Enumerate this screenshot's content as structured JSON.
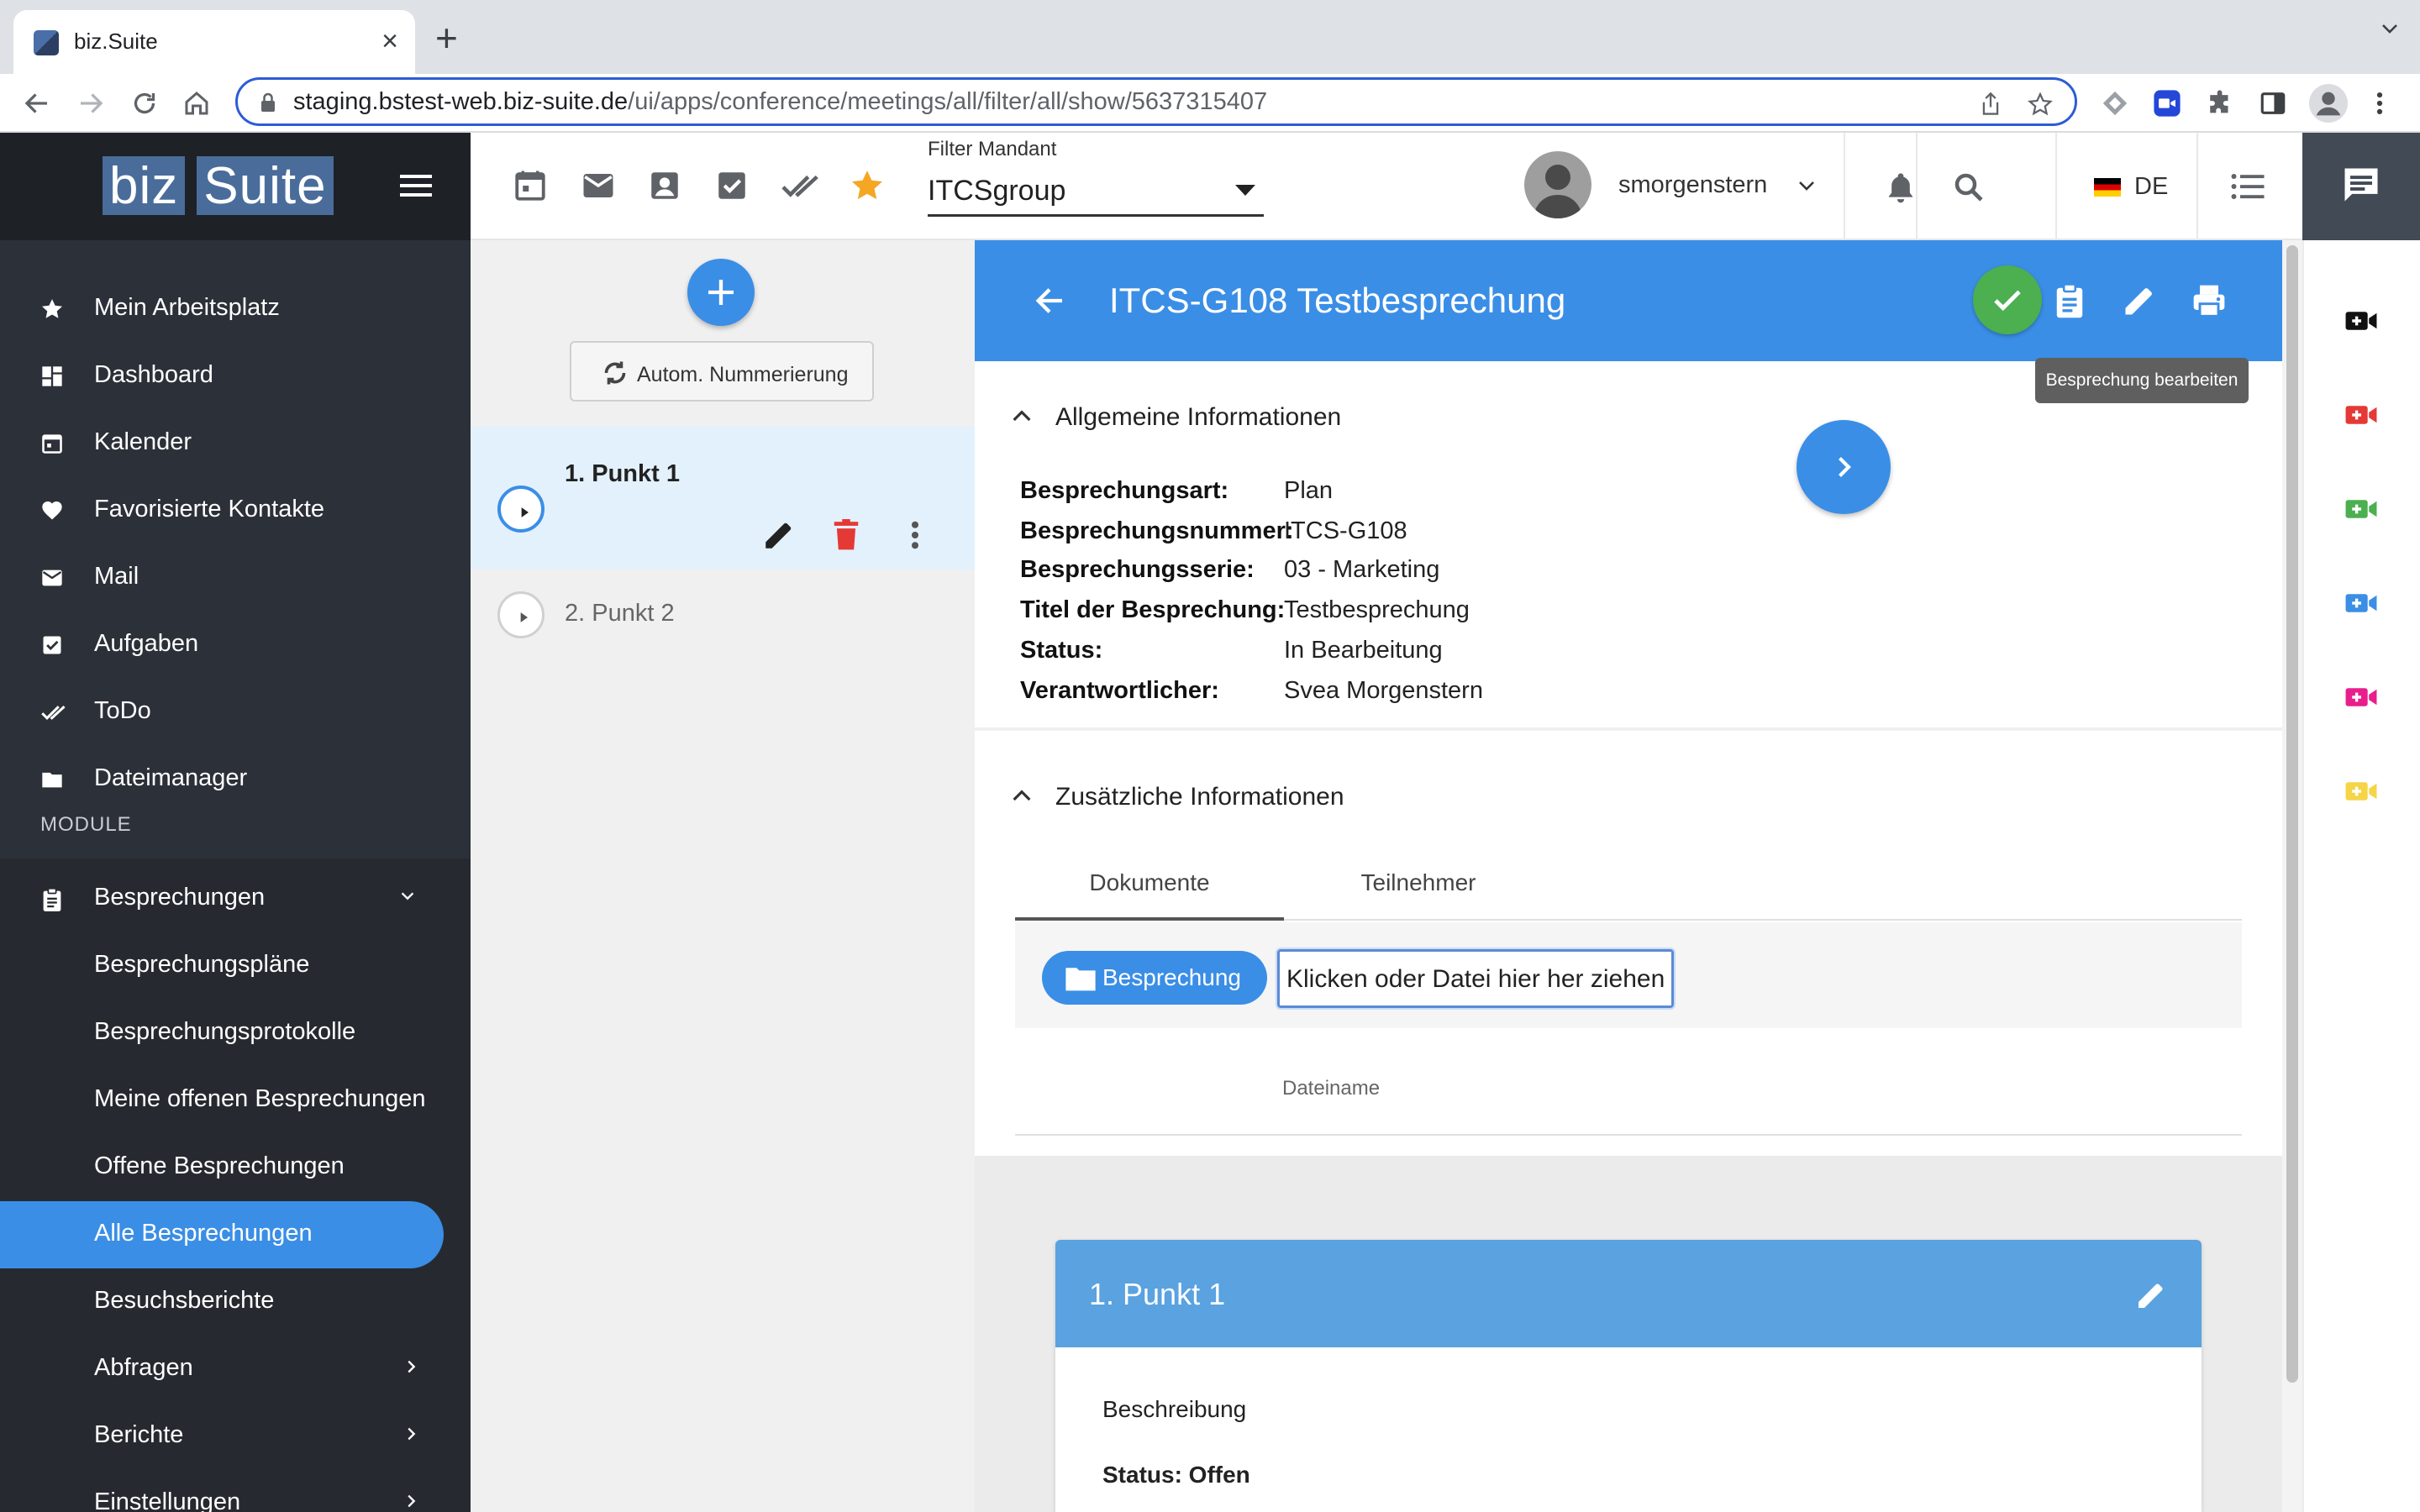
{
  "browser": {
    "tab_title": "biz.Suite",
    "url_host": "staging.bstest-web.biz-suite.de",
    "url_path": "/ui/apps/conference/meetings/all/filter/all/show/5637315407"
  },
  "logo": {
    "left": "biz",
    "right": "Suite"
  },
  "header": {
    "filter_label": "Filter Mandant",
    "filter_value": "ITCSgroup",
    "username": "smorgenstern",
    "language": "DE"
  },
  "sidebar": {
    "items": [
      {
        "label": "Mein Arbeitsplatz",
        "icon": "star-icon"
      },
      {
        "label": "Dashboard",
        "icon": "dashboard-icon"
      },
      {
        "label": "Kalender",
        "icon": "calendar-icon"
      },
      {
        "label": "Favorisierte Kontakte",
        "icon": "heart-icon"
      },
      {
        "label": "Mail",
        "icon": "mail-icon"
      },
      {
        "label": "Aufgaben",
        "icon": "task-icon"
      },
      {
        "label": "ToDo",
        "icon": "double-check-icon"
      },
      {
        "label": "Dateimanager",
        "icon": "folder-icon"
      }
    ],
    "module_label": "MODULE",
    "module": {
      "label": "Besprechungen",
      "icon": "clipboard-icon"
    },
    "subitems": [
      {
        "label": "Besprechungspläne"
      },
      {
        "label": "Besprechungsprotokolle"
      },
      {
        "label": "Meine offenen Besprechungen"
      },
      {
        "label": "Offene Besprechungen"
      },
      {
        "label": "Alle Besprechungen",
        "active": true
      },
      {
        "label": "Besuchsberichte"
      },
      {
        "label": "Abfragen"
      },
      {
        "label": "Berichte"
      },
      {
        "label": "Einstellungen"
      }
    ]
  },
  "points_panel": {
    "auto_number_label": "Autom. Nummerierung",
    "points": [
      "1. Punkt 1",
      "2. Punkt 2"
    ]
  },
  "meeting": {
    "title": "ITCS-G108 Testbesprechung",
    "tooltip": "Besprechung bearbeiten",
    "general_section": "Allgemeine Informationen",
    "fields": [
      {
        "key": "Besprechungsart:",
        "value": "Plan"
      },
      {
        "key": "Besprechungsnummer:",
        "value": "ITCS-G108"
      },
      {
        "key": "Besprechungsserie:",
        "value": "03 - Marketing"
      },
      {
        "key": "Titel der Besprechung:",
        "value": "Testbesprechung"
      },
      {
        "key": "Status:",
        "value": "In Bearbeitung"
      },
      {
        "key": "Verantwortlicher:",
        "value": "Svea Morgenstern"
      }
    ],
    "extra_section": "Zusätzliche Informationen",
    "tabs": [
      "Dokumente",
      "Teilnehmer"
    ],
    "folder_button": "Besprechung",
    "drop_zone": "Klicken oder Datei hier her ziehen",
    "file_column": "Dateiname",
    "point_card": {
      "title": "1. Punkt 1",
      "description_label": "Beschreibung",
      "status": "Status: Offen"
    }
  },
  "colors": {
    "primary": "#3a8ee6",
    "sidebar_bg": "#2c3038",
    "success": "#4caf50",
    "danger": "#e53935",
    "rail_icons": [
      "#111111",
      "#e53935",
      "#4caf50",
      "#3a8ee6",
      "#e91e8c",
      "#f5d547"
    ]
  }
}
